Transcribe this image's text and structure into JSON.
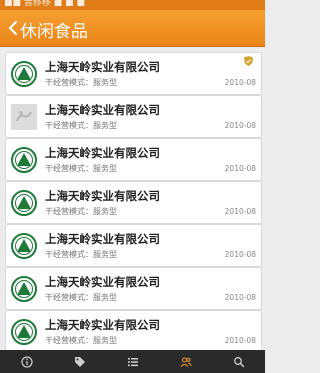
{
  "status_bar": {
    "text": "■■ 晋移移 ■ ■ ■"
  },
  "header": {
    "title": "休闲食品",
    "back_icon": "chevron-left-icon"
  },
  "colors": {
    "accent": "#f29a2e",
    "logo_green": "#1f7a3a",
    "tabbar": "#2a2a2a",
    "active_tab": "#f29a2e"
  },
  "items": [
    {
      "name": "上海天岭实业有限公司",
      "mode": "干经营模式：服务型",
      "date": "2010-08",
      "logo": "green-seal-logo",
      "badge": "gold-shield-icon"
    },
    {
      "name": "上海天岭实业有限公司",
      "mode": "干经营模式：服务型",
      "date": "2010-08",
      "logo": "gray-placeholder-logo"
    },
    {
      "name": "上海天岭实业有限公司",
      "mode": "干经营模式：服务型",
      "date": "2010-08",
      "logo": "green-seal-logo"
    },
    {
      "name": "上海天岭实业有限公司",
      "mode": "干经营模式：服务型",
      "date": "2010-08",
      "logo": "green-seal-logo"
    },
    {
      "name": "上海天岭实业有限公司",
      "mode": "干经营模式：服务型",
      "date": "2010-08",
      "logo": "green-seal-logo"
    },
    {
      "name": "上海天岭实业有限公司",
      "mode": "干经营模式：服务型",
      "date": "2010-08",
      "logo": "green-seal-logo"
    },
    {
      "name": "上海天岭实业有限公司",
      "mode": "干经营模式：服务型",
      "date": "2010-08",
      "logo": "green-seal-logo"
    }
  ],
  "tabbar": {
    "tabs": [
      {
        "icon": "info-icon",
        "active": false
      },
      {
        "icon": "tag-icon",
        "active": false
      },
      {
        "icon": "list-icon",
        "active": false
      },
      {
        "icon": "users-icon",
        "active": true
      },
      {
        "icon": "search-icon",
        "active": false
      }
    ]
  }
}
